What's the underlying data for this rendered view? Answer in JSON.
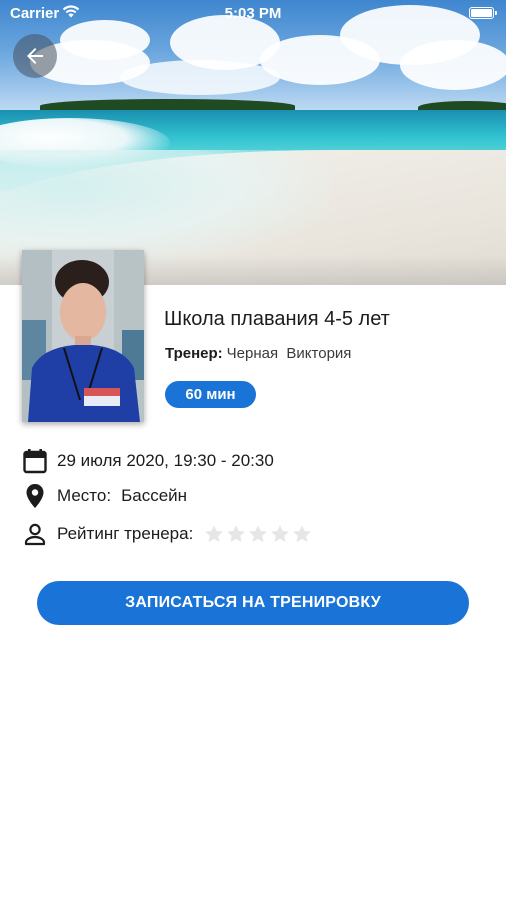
{
  "status_bar": {
    "carrier": "Carrier",
    "time": "5:03 PM",
    "battery_level": 1.0
  },
  "header": {
    "back_icon": "arrow-left-icon",
    "hero_image": "tropical-beach"
  },
  "course": {
    "title": "Школа плавания 4-5 лет",
    "trainer_label": "Тренер:",
    "trainer_name": "Черная  Виктория",
    "duration": "60 мин"
  },
  "details": {
    "date_icon": "calendar-icon",
    "date": "29 июля 2020, 19:30 - 20:30",
    "place_icon": "location-pin-icon",
    "place_label": "Место:",
    "place_value": "Бассейн",
    "rating_icon": "person-icon",
    "rating_label": "Рейтинг тренера:",
    "rating_value": 0,
    "rating_max": 5
  },
  "actions": {
    "enroll_label": "ЗАПИСАТЬСЯ НА ТРЕНИРОВКУ"
  },
  "colors": {
    "accent": "#1a73d6",
    "star_empty": "#e6e6e6",
    "text": "#1c1c1c"
  }
}
